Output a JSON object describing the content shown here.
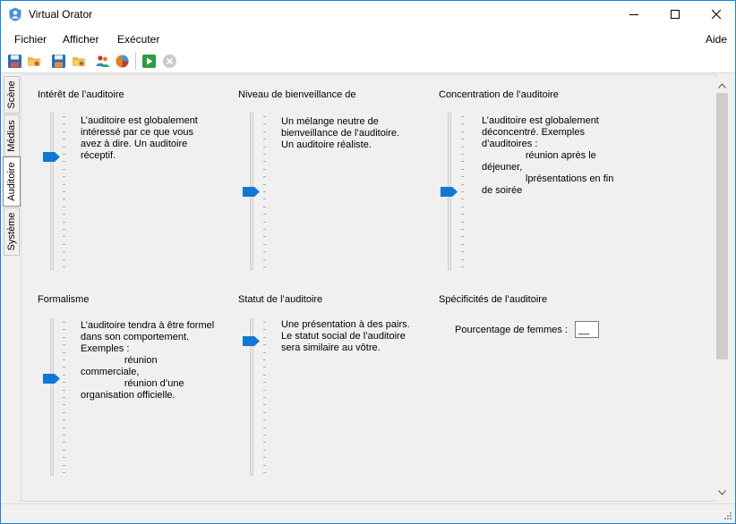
{
  "window": {
    "title": "Virtual Orator",
    "icons": {
      "app": "orator-app-icon",
      "minimize": "minimize-icon",
      "maximize": "maximize-icon",
      "close": "close-icon"
    }
  },
  "menu": {
    "left": [
      "Fichier",
      "Afficher",
      "Exécuter"
    ],
    "right": "Aide"
  },
  "toolbar": {
    "icons": [
      "save-icon",
      "open-folder-icon",
      "save-as-icon",
      "open-media-icon",
      "audience-people-icon",
      "globe-icon",
      "play-icon",
      "stop-icon"
    ]
  },
  "tabs": {
    "items": [
      "Scène",
      "Médias",
      "Auditoire",
      "Système"
    ],
    "active": "Auditoire"
  },
  "groups": {
    "interest": {
      "title": "Intérêt de l’auditoire",
      "description": "L’auditoire est globalement\nintéressé par ce que vous\navez à dire. Un auditoire\nréceptif.",
      "level": 0.73
    },
    "benevolence": {
      "title": "Niveau de bienveillance de",
      "description": "Un mélange neutre de\nbienveillance de l’auditoire.\nUn auditoire réaliste.",
      "level": 0.5
    },
    "concentration": {
      "title": "Concentration de l’auditoire",
      "description": "L’auditoire est globalement\ndéconcentré. Exemples\nd’auditoires :\n                réunion après le\ndéjeuner,\n                lprésentations en fin\nde soirée",
      "level": 0.5
    },
    "formalism": {
      "title": "Formalisme",
      "description": "L’auditoire tendra à être formel\ndans son comportement.\nExemples :\n                réunion\ncommerciale,\n                réunion d’une\norganisation officielle.",
      "level": 0.62
    },
    "status": {
      "title": "Statut de l’auditoire",
      "description": "Une présentation à des pairs.\nLe statut social de l’auditoire\nsera similaire au vôtre.",
      "level": 0.87
    },
    "specifics": {
      "title": "Spécificités de l’auditoire",
      "women_label": "Pourcentage de femmes :",
      "women_value": "__"
    }
  },
  "colors": {
    "accent": "#1177d4",
    "window_border": "#1883d7"
  }
}
